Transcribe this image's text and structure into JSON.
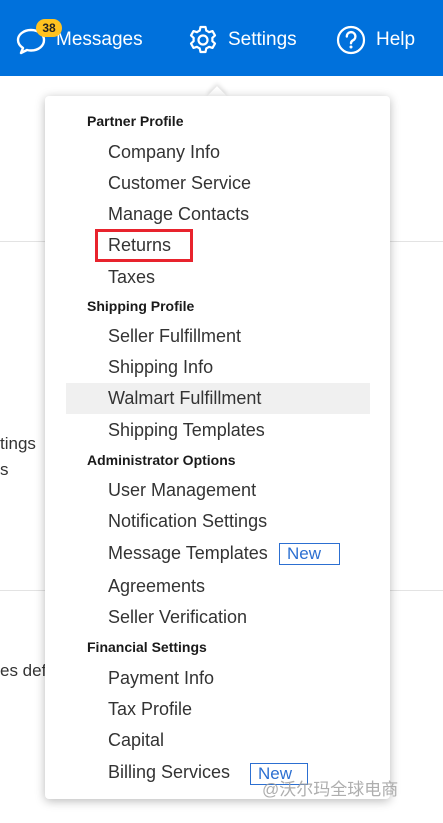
{
  "topbar": {
    "messages": {
      "label": "Messages",
      "badge": "38"
    },
    "settings": {
      "label": "Settings"
    },
    "help": {
      "label": "Help"
    }
  },
  "background_text": [
    "tings",
    "s",
    "es defi"
  ],
  "menu": {
    "sections": [
      {
        "title": "Partner Profile",
        "items": [
          "Company Info",
          "Customer Service",
          "Manage Contacts",
          "Returns",
          "Taxes"
        ]
      },
      {
        "title": "Shipping Profile",
        "items": [
          "Seller Fulfillment",
          "Shipping Info",
          "Walmart Fulfillment",
          "Shipping Templates"
        ]
      },
      {
        "title": "Administrator Options",
        "items": [
          "User Management",
          "Notification Settings",
          "Message Templates",
          "Agreements",
          "Seller Verification"
        ]
      },
      {
        "title": "Financial Settings",
        "items": [
          "Payment Info",
          "Tax Profile",
          "Capital",
          "Billing Services"
        ]
      }
    ],
    "new_badge": "New",
    "highlighted_item": "Returns",
    "hovered_item": "Walmart Fulfillment"
  },
  "watermark": "@沃尔玛全球电商",
  "colors": {
    "brand_blue": "#0071dc",
    "badge_yellow": "#ffc220",
    "highlight_red": "#e8232d",
    "link_blue": "#2c6fd1"
  }
}
